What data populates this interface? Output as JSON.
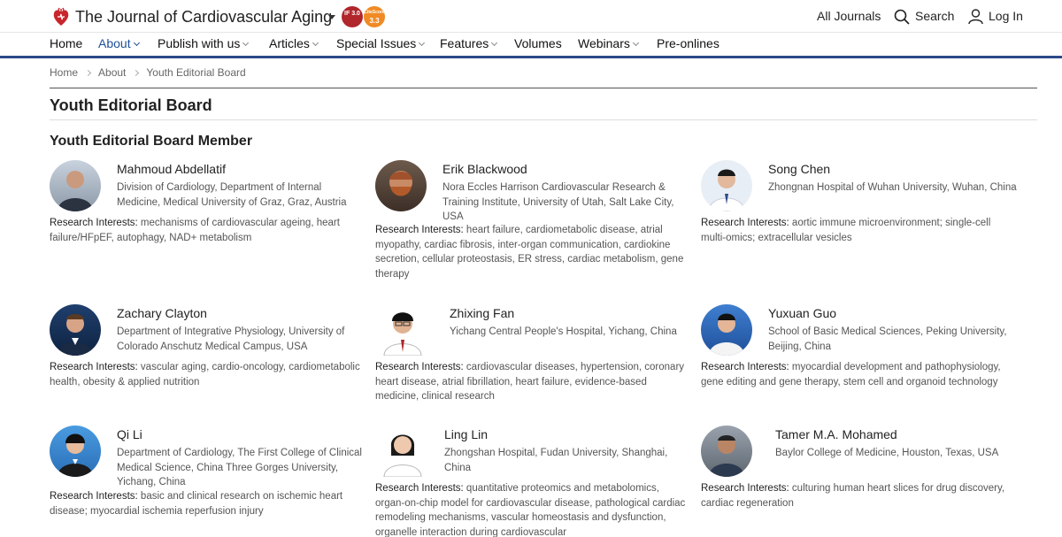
{
  "header": {
    "journal_title": "The Journal of Cardiovascular Aging",
    "impact_factor_badge": "IF 3.0",
    "citescore_badge_label": "CiteScore",
    "citescore_badge_value": "3.3",
    "all_journals": "All Journals",
    "search": "Search",
    "login": "Log In",
    "brand_color": "#1e4f9b",
    "accent_red": "#b0262b",
    "accent_orange": "#f08a24"
  },
  "nav": {
    "items": [
      {
        "label": "Home"
      },
      {
        "label": "About"
      },
      {
        "label": "Publish with us"
      },
      {
        "label": "Articles"
      },
      {
        "label": "Special Issues"
      },
      {
        "label": "Features"
      },
      {
        "label": "Volumes"
      },
      {
        "label": "Webinars"
      },
      {
        "label": "Pre-onlines"
      }
    ]
  },
  "breadcrumb": {
    "items": [
      "Home",
      "About",
      "Youth Editorial Board"
    ]
  },
  "page": {
    "title": "Youth Editorial Board",
    "section_title": "Youth Editorial Board Member",
    "interest_label": "Research Interests:"
  },
  "members": [
    {
      "name": "Mahmoud Abdellatif",
      "affiliation": "Division of Cardiology, Department of Internal Medicine, Medical University of Graz, Graz, Austria",
      "interests": "mechanisms of cardiovascular ageing, heart failure/HFpEF, autophagy, NAD+ metabolism"
    },
    {
      "name": "Erik Blackwood",
      "affiliation": "Nora Eccles Harrison Cardiovascular Research & Training Institute, University of Utah, Salt Lake City, USA",
      "interests": "heart failure, cardiometabolic disease, atrial myopathy, cardiac fibrosis, inter-organ communication, cardiokine secretion, cellular proteostasis, ER stress, cardiac metabolism, gene therapy"
    },
    {
      "name": "Song Chen",
      "affiliation": "Zhongnan Hospital of Wuhan University, Wuhan, China",
      "interests": "aortic immune microenvironment; single-cell multi-omics; extracellular vesicles"
    },
    {
      "name": "Zachary Clayton",
      "affiliation": "Department of Integrative Physiology, University of Colorado Anschutz Medical Campus, USA",
      "interests": "vascular aging, cardio-oncology, cardiometabolic health, obesity & applied nutrition"
    },
    {
      "name": "Zhixing Fan",
      "affiliation": "Yichang Central People's Hospital, Yichang, China",
      "interests": "cardiovascular diseases, hypertension, coronary heart disease, atrial fibrillation, heart failure, evidence-based medicine, clinical research"
    },
    {
      "name": "Yuxuan Guo",
      "affiliation": "School of Basic Medical Sciences, Peking University, Beijing, China",
      "interests": "myocardial development and pathophysiology, gene editing and gene therapy, stem cell and organoid technology"
    },
    {
      "name": "Qi Li",
      "affiliation": "Department of Cardiology, The First College of Clinical Medical Science, China Three Gorges University, Yichang, China",
      "interests": "basic and clinical research on ischemic heart disease; myocardial ischemia reperfusion injury"
    },
    {
      "name": "Ling Lin",
      "affiliation": "Zhongshan Hospital, Fudan University, Shanghai, China",
      "interests": "quantitative proteomics and metabolomics, organ-on-chip model for cardiovascular disease, pathological cardiac remodeling mechanisms, vascular homeostasis and dysfunction, organelle interaction during cardiovascular"
    },
    {
      "name": "Tamer M.A. Mohamed",
      "affiliation": "Baylor College of Medicine, Houston, Texas, USA",
      "interests": "culturing human heart slices for drug discovery, cardiac regeneration"
    }
  ]
}
